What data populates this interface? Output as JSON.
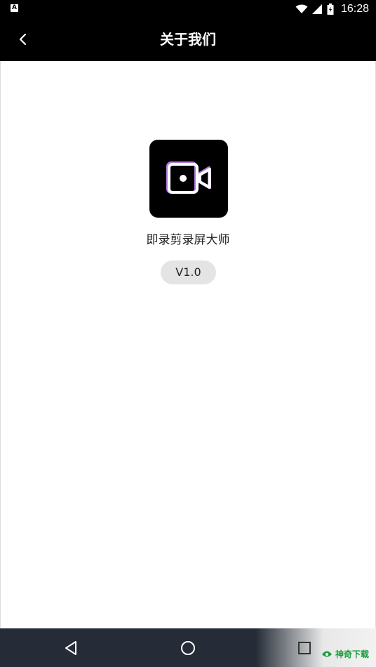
{
  "status_bar": {
    "left_icon": "A",
    "icons": [
      "wifi-icon",
      "signal-icon",
      "battery-icon"
    ],
    "time": "16:28"
  },
  "app_bar": {
    "back_icon": "chevron-left-icon",
    "title": "关于我们"
  },
  "about": {
    "app_icon": "video-camera-icon",
    "app_name": "即录剪录屏大师",
    "version": "V1.0"
  },
  "nav_bar": {
    "buttons": [
      "back-triangle-icon",
      "home-circle-icon",
      "recents-square-icon"
    ]
  },
  "watermark": {
    "text": "神奇下载"
  },
  "colors": {
    "header_bg": "#000000",
    "nav_bg": "#252c37",
    "icon_accent": "#b77be0",
    "pill_bg": "#e4e4e4"
  }
}
